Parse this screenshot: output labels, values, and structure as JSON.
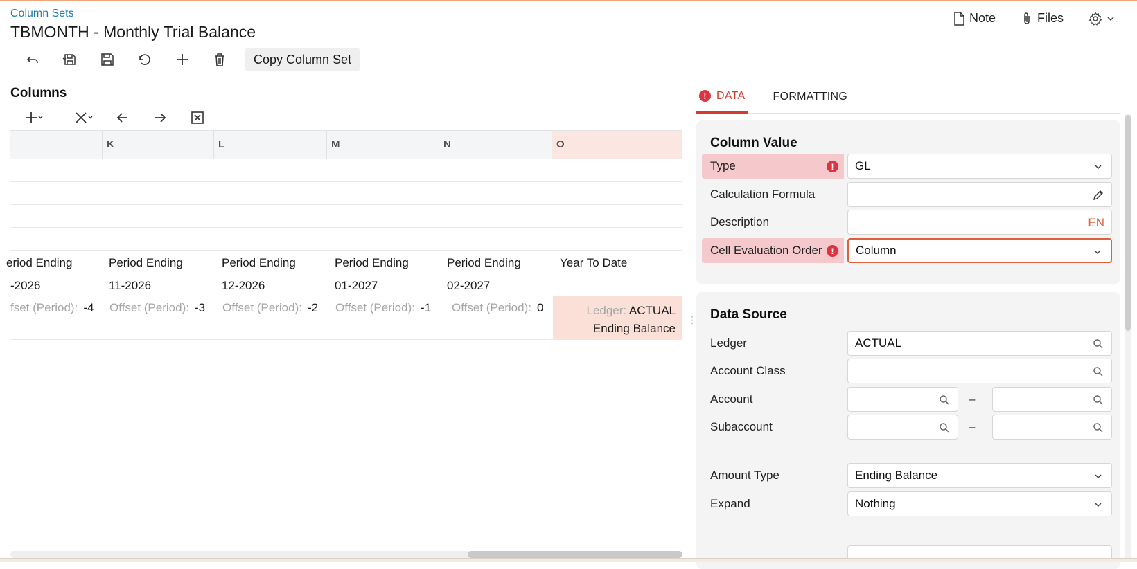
{
  "header": {
    "breadcrumb": "Column Sets",
    "title": "TBMONTH - Monthly Trial Balance",
    "note_label": "Note",
    "files_label": "Files"
  },
  "toolbar": {
    "icons": [
      "undo-back-icon",
      "save-close-icon",
      "save-icon",
      "cancel-changes-icon",
      "add-icon",
      "delete-icon"
    ],
    "copy_label": "Copy Column Set"
  },
  "columns": {
    "title": "Columns",
    "tools": [
      "add-dropdown-icon",
      "remove-dropdown-icon",
      "move-left-icon",
      "move-right-icon",
      "export-excel-icon"
    ],
    "headers": [
      "K",
      "L",
      "M",
      "N",
      "O"
    ],
    "row_description": [
      "eriod Ending",
      "Period Ending",
      "Period Ending",
      "Period Ending",
      "Period Ending",
      "Year To Date"
    ],
    "row_period": [
      "-2026",
      "11-2026",
      "12-2026",
      "01-2027",
      "02-2027"
    ],
    "offset_label_partial": "fset (Period):",
    "offset_label": "Offset (Period):",
    "offset_values": [
      "-4",
      "-3",
      "-2",
      "-1",
      "0"
    ],
    "selected_ledger_label": "Ledger:",
    "selected_ledger_value": "ACTUAL",
    "selected_amount_type": "Ending Balance"
  },
  "tabs": {
    "data": "DATA",
    "formatting": "FORMATTING"
  },
  "column_value": {
    "title": "Column Value",
    "type_label": "Type",
    "type_value": "GL",
    "formula_label": "Calculation Formula",
    "formula_value": "",
    "description_label": "Description",
    "description_value": "",
    "description_lang": "EN",
    "order_label": "Cell Evaluation Order",
    "order_value": "Column"
  },
  "data_source": {
    "title": "Data Source",
    "ledger_label": "Ledger",
    "ledger_value": "ACTUAL",
    "account_class_label": "Account Class",
    "account_class_value": "",
    "account_label": "Account",
    "account_from": "",
    "account_to": "",
    "subaccount_label": "Subaccount",
    "subaccount_from": "",
    "subaccount_to": "",
    "range_separator": "–",
    "amount_type_label": "Amount Type",
    "amount_type_value": "Ending Balance",
    "expand_label": "Expand",
    "expand_value": "Nothing"
  },
  "colors": {
    "accent": "#d43c2f",
    "link": "#1f7ab5",
    "error_bg": "#f5c8cc",
    "selected_col": "#fbe0d8"
  }
}
